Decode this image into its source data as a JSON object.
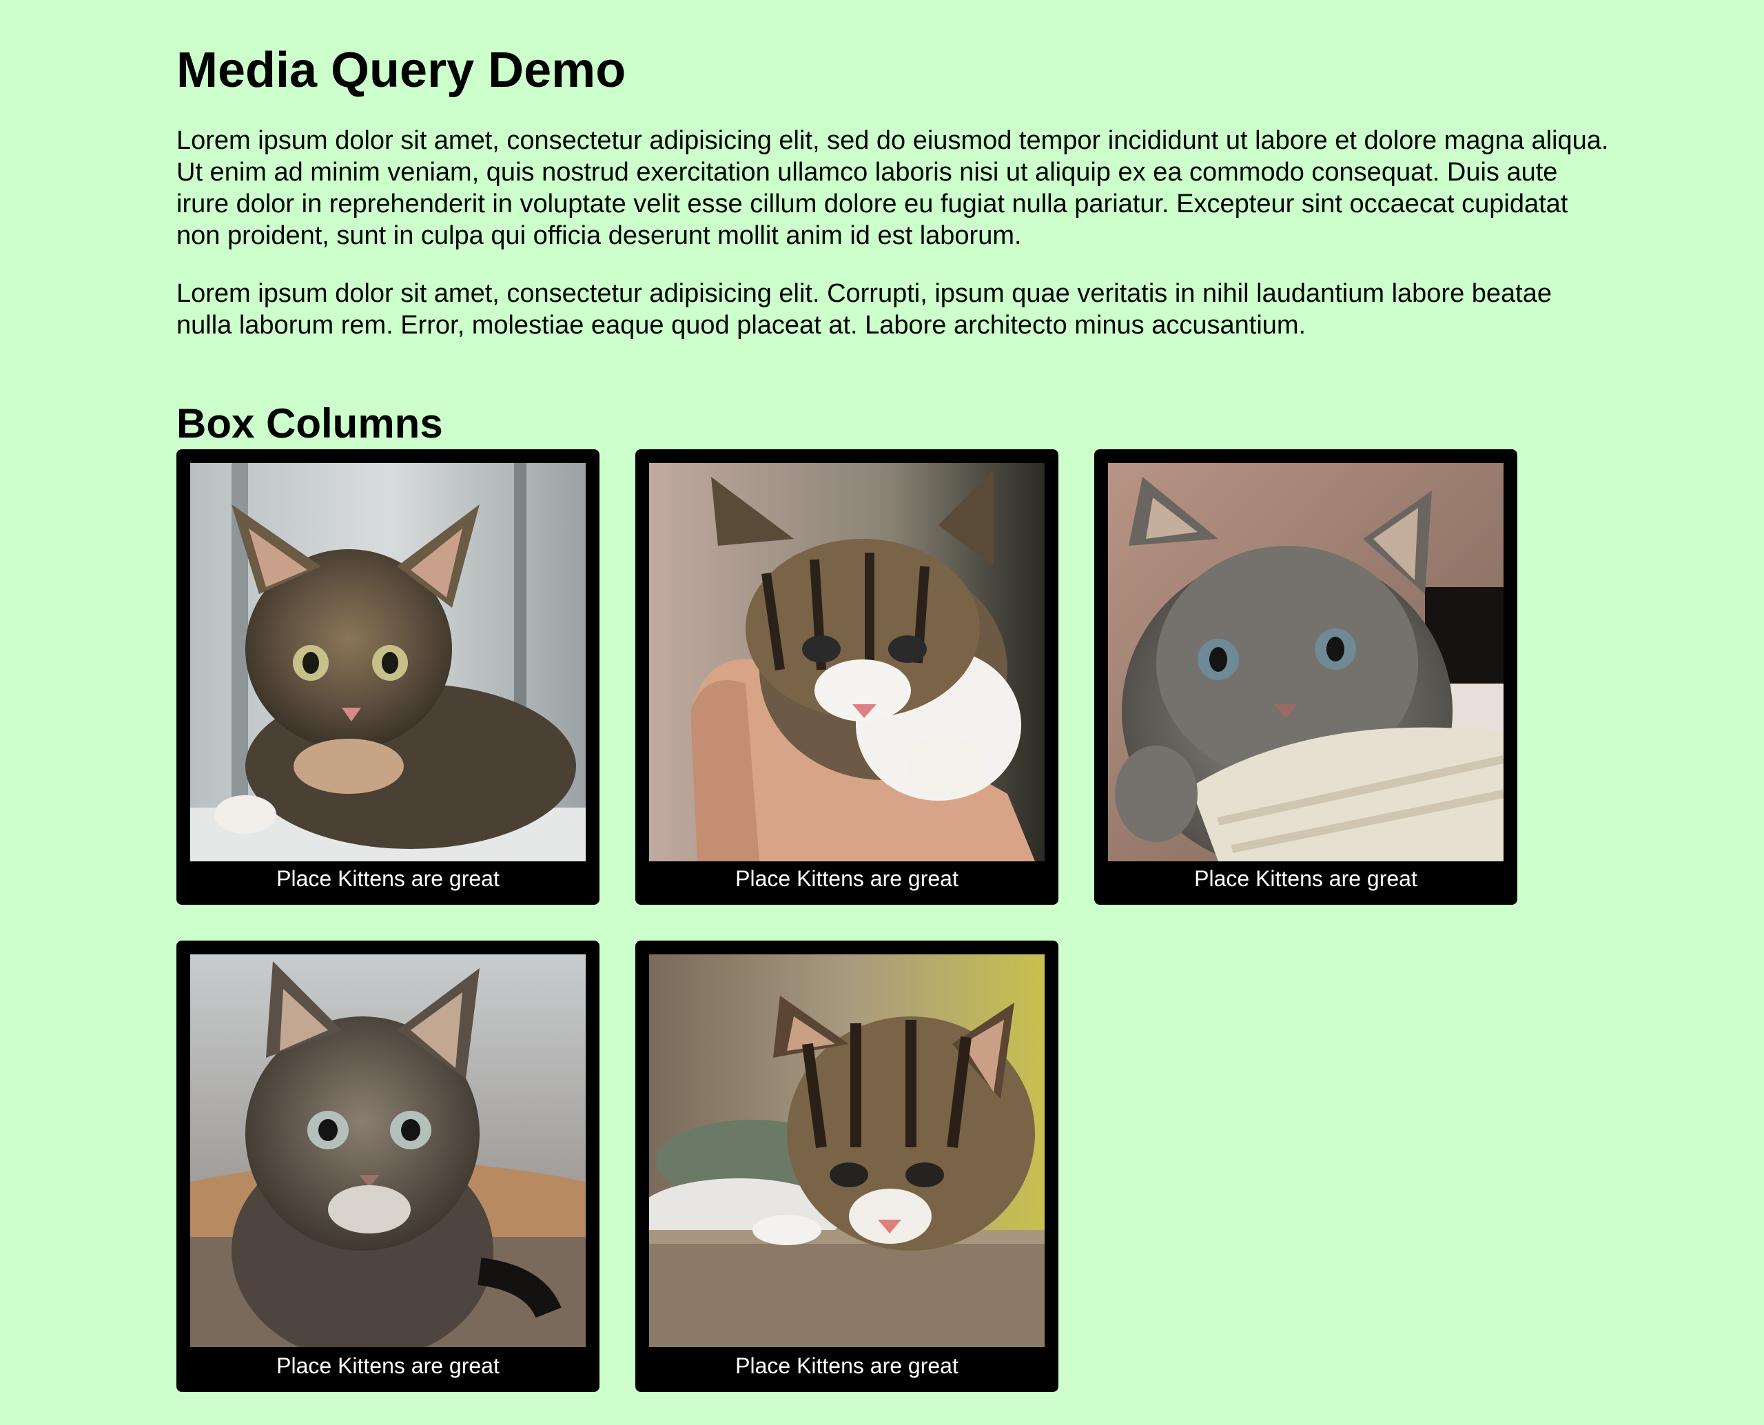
{
  "page": {
    "title": "Media Query Demo",
    "paragraphs": [
      "Lorem ipsum dolor sit amet, consectetur adipisicing elit, sed do eiusmod tempor incididunt ut labore et dolore magna aliqua. Ut enim ad minim veniam, quis nostrud exercitation ullamco laboris nisi ut aliquip ex ea commodo consequat. Duis aute irure dolor in reprehenderit in voluptate velit esse cillum dolore eu fugiat nulla pariatur. Excepteur sint occaecat cupidatat non proident, sunt in culpa qui officia deserunt mollit anim id est laborum.",
      "Lorem ipsum dolor sit amet, consectetur adipisicing elit. Corrupti, ipsum quae veritatis in nihil laudantium labore beatae nulla laborum rem. Error, molestiae eaque quod placeat at. Labore architecto minus accusantium."
    ],
    "section_title": "Box Columns"
  },
  "boxes": [
    {
      "caption": "Place Kittens are great"
    },
    {
      "caption": "Place Kittens are great"
    },
    {
      "caption": "Place Kittens are great"
    },
    {
      "caption": "Place Kittens are great"
    },
    {
      "caption": "Place Kittens are great"
    }
  ],
  "colors": {
    "background": "#ccffcc",
    "box": "#000000",
    "caption_text": "#ffffff"
  }
}
